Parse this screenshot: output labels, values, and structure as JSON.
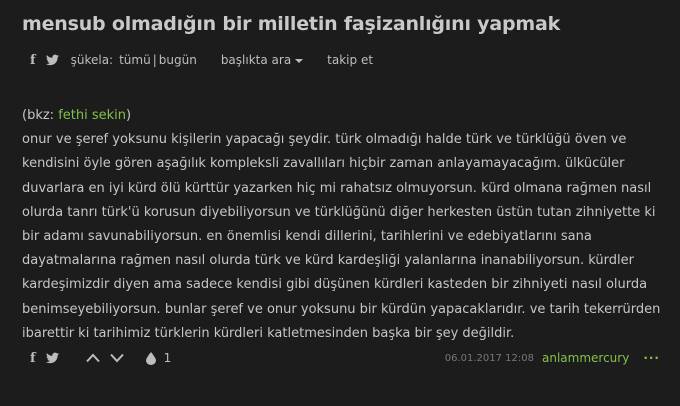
{
  "topic": {
    "title": "mensub olmadığın bir milletin faşizanlığını yapmak"
  },
  "subnav": {
    "sukela_label": "şükela:",
    "all_label": "tümü",
    "separator": "|",
    "today_label": "bugün",
    "search_label": "başlıkta ara",
    "follow_label": "takip et"
  },
  "entry": {
    "bkz_open": "(bkz: ",
    "bkz_link": "fethi sekin",
    "bkz_close": ")",
    "body": "onur ve şeref yoksunu kişilerin yapacağı şeydir. türk olmadığı halde türk ve türklüğü öven ve kendisini öyle gören aşağılık kompleksli zavallıları hiçbir zaman anlayamayacağım. ülkücüler duvarlara en iyi kürd ölü kürttür yazarken hiç mi rahatsız olmuyorsun. kürd olmana rağmen nasıl olurda tanrı türk'ü korusun diyebiliyorsun ve türklüğünü diğer herkesten üstün tutan zihniyette ki bir adamı savunabiliyorsun. en önemlisi kendi dillerini, tarihlerini ve edebiyatlarını sana dayatmalarına rağmen nasıl olurda türk ve kürd kardeşliği yalanlarına inanabiliyorsun. kürdler kardeşimizdir diyen ama sadece kendisi gibi düşünen kürdleri kasteden bir zihniyeti nasıl olurda benimseyebiliyorsun. bunlar şeref ve onur yoksunu bir kürdün yapacaklarıdır. ve tarih tekerrürden ibarettir ki tarihimiz türklerin kürdleri katletmesinden başka bir şey değildir."
  },
  "footer": {
    "fav_count": "1",
    "date": "06.01.2017 12:08",
    "author": "anlammercury",
    "more": "···"
  },
  "colors": {
    "background": "#1c1c1c",
    "text": "#c6c6c6",
    "accent": "#81c14b",
    "muted": "#777777"
  },
  "icons": [
    "facebook-icon",
    "twitter-icon",
    "caret-down-icon",
    "upvote-icon",
    "downvote-icon",
    "drop-icon",
    "more-icon"
  ]
}
